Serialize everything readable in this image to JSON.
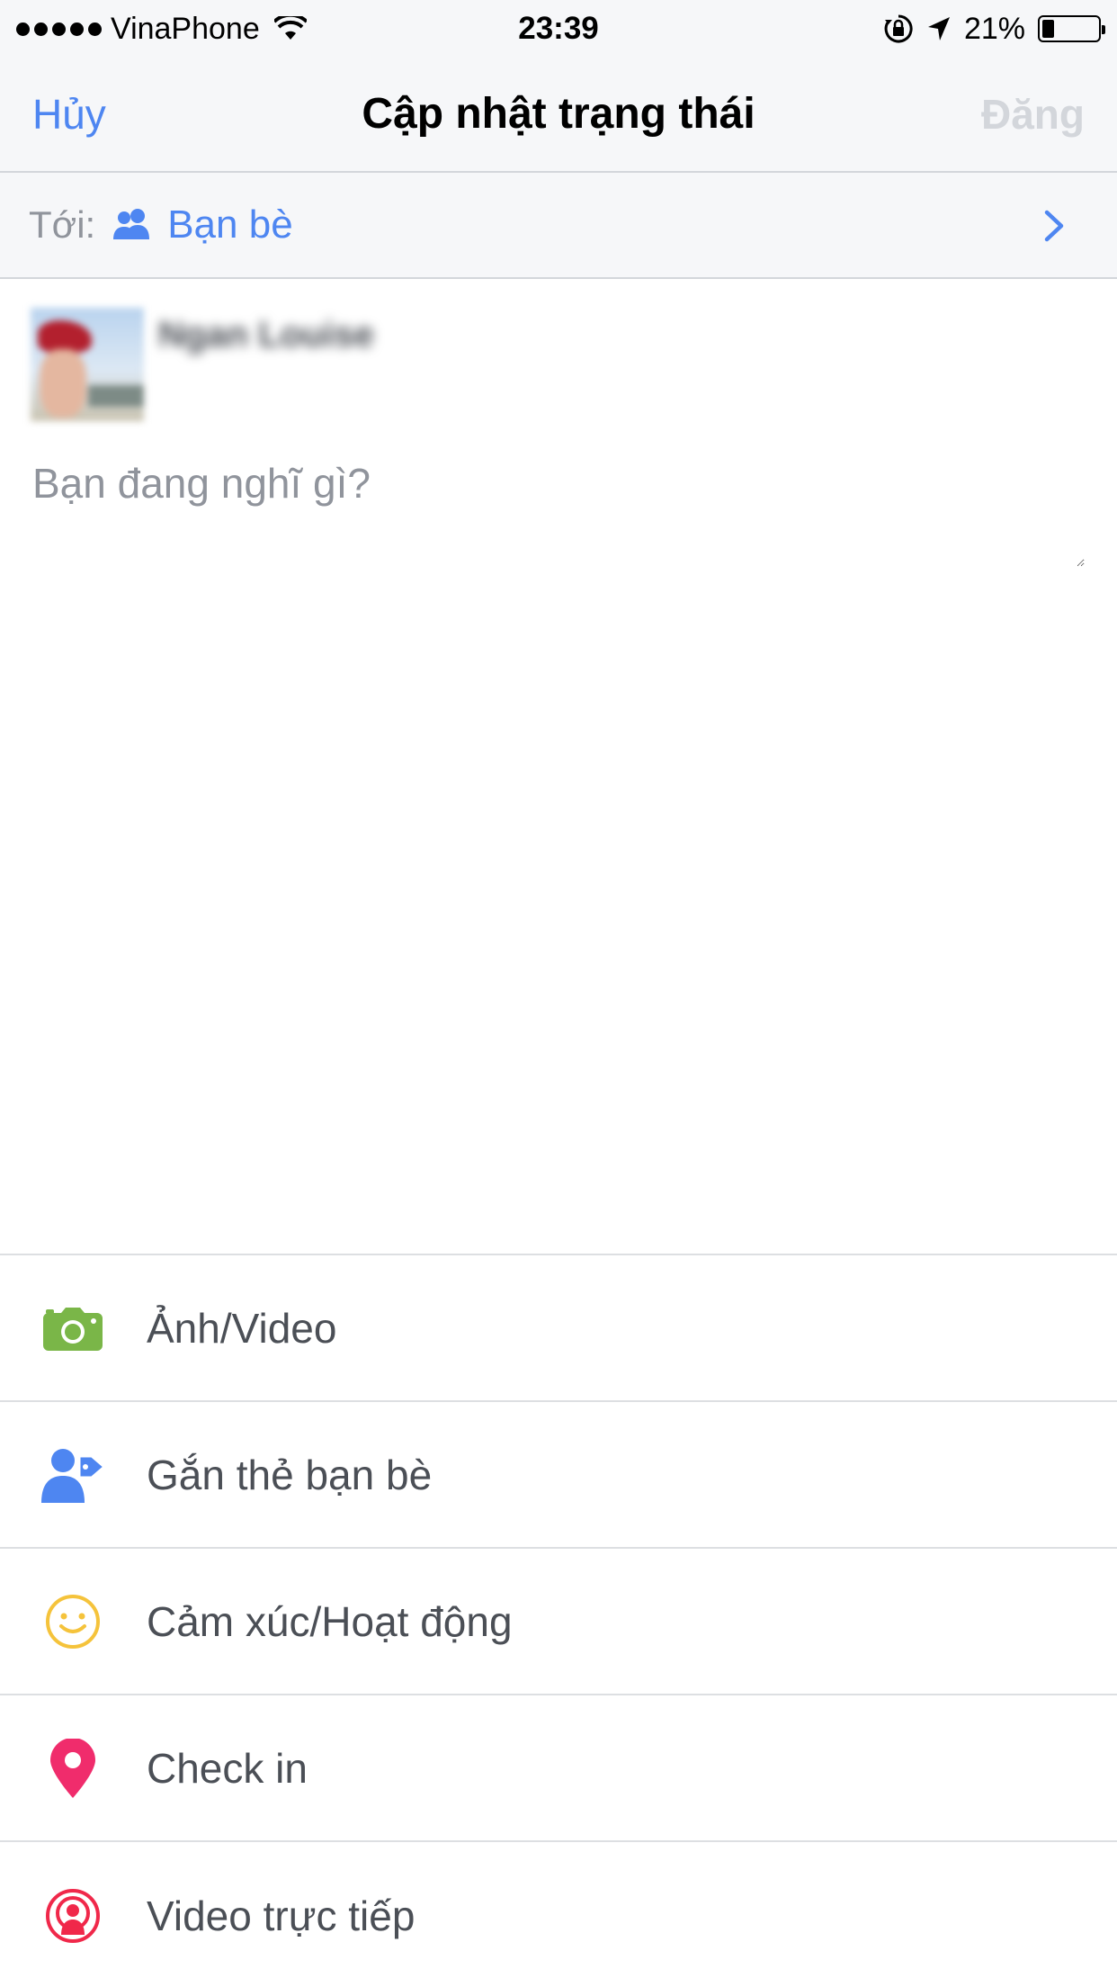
{
  "status_bar": {
    "carrier": "VinaPhone",
    "time": "23:39",
    "battery_percent": "21%",
    "battery_level": 0.21,
    "icons": [
      "signal-dots",
      "wifi-icon",
      "orientation-lock-icon",
      "location-arrow-icon",
      "battery-icon"
    ]
  },
  "nav": {
    "cancel_label": "Hủy",
    "title": "Cập nhật trạng thái",
    "post_label": "Đăng"
  },
  "audience": {
    "label": "Tới:",
    "value": "Bạn bè",
    "icon": "friends-icon"
  },
  "composer": {
    "user_name": "Ngan Louise",
    "placeholder": "Bạn đang nghĩ gì?",
    "value": ""
  },
  "actions": [
    {
      "label": "Ảnh/Video",
      "icon": "camera-icon",
      "color": "#7ab648"
    },
    {
      "label": "Gắn thẻ bạn bè",
      "icon": "tag-friend-icon",
      "color": "#4e86f1"
    },
    {
      "label": "Cảm xúc/Hoạt động",
      "icon": "smiley-icon",
      "color": "#f5c33b"
    },
    {
      "label": "Check in",
      "icon": "location-pin-icon",
      "color": "#f02c6c"
    },
    {
      "label": "Video trực tiếp",
      "icon": "live-video-icon",
      "color": "#f0284a"
    }
  ],
  "colors": {
    "accent": "#4e86f1",
    "disabled": "#d3d6db",
    "bar_background": "#f6f7f9",
    "text_secondary": "#90949c",
    "text_primary": "#4b4f56"
  }
}
